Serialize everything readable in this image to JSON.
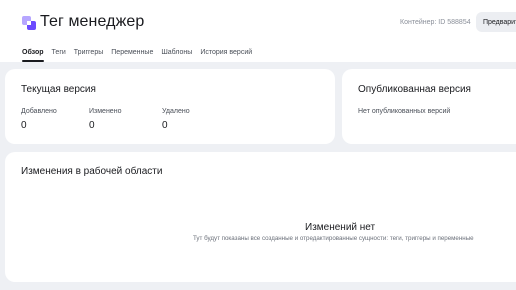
{
  "app": {
    "title": "Тег менеджер",
    "logo_icon": "gtm-logo-icon"
  },
  "header": {
    "container_id": "Контейнер: ID 588854",
    "preview_button": "Предварительный просмотр"
  },
  "tabs": [
    {
      "label": "Обзор",
      "active": true
    },
    {
      "label": "Теги",
      "active": false
    },
    {
      "label": "Триггеры",
      "active": false
    },
    {
      "label": "Переменные",
      "active": false
    },
    {
      "label": "Шаблоны",
      "active": false
    },
    {
      "label": "История версий",
      "active": false
    }
  ],
  "current_version": {
    "title": "Текущая версия",
    "stats": [
      {
        "label": "Добавлено",
        "value": "0"
      },
      {
        "label": "Изменено",
        "value": "0"
      },
      {
        "label": "Удалено",
        "value": "0"
      }
    ]
  },
  "published_version": {
    "title": "Опубликованная версия",
    "empty_text": "Нет опубликованных версий"
  },
  "workspace_changes": {
    "title": "Изменения в рабочей области",
    "empty_title": "Изменений нет",
    "empty_description": "Тут будут показаны все созданные и отредактированные сущности: теги, триггеры и переменные"
  },
  "colors": {
    "background": "#eef0f4",
    "card": "#ffffff",
    "logo_primary": "#6c4bff",
    "logo_secondary": "#b6a6ff"
  }
}
